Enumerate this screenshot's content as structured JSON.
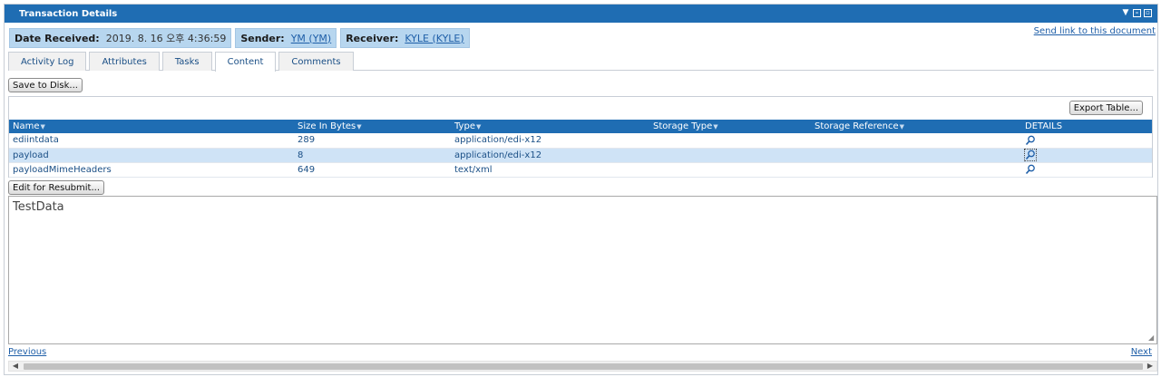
{
  "window": {
    "title": "Transaction Details"
  },
  "info": {
    "date_label": "Date Received:",
    "date_value": "2019. 8. 16 오후 4:36:59",
    "sender_label": "Sender:",
    "sender_value": "YM (YM)",
    "receiver_label": "Receiver:",
    "receiver_value": "KYLE (KYLE)",
    "send_link": "Send link to this document"
  },
  "tabs": [
    {
      "label": "Activity Log",
      "active": false
    },
    {
      "label": "Attributes",
      "active": false
    },
    {
      "label": "Tasks",
      "active": false
    },
    {
      "label": "Content",
      "active": true
    },
    {
      "label": "Comments",
      "active": false
    }
  ],
  "buttons": {
    "save": "Save to Disk...",
    "export": "Export Table...",
    "resubmit": "Edit for Resubmit..."
  },
  "table": {
    "columns": [
      "Name",
      "Size In Bytes",
      "Type",
      "Storage Type",
      "Storage Reference",
      "DETAILS"
    ],
    "rows": [
      {
        "name": "ediintdata",
        "size": "289",
        "type": "application/edi-x12",
        "storage_type": "",
        "storage_reference": ""
      },
      {
        "name": "payload",
        "size": "8",
        "type": "application/edi-x12",
        "storage_type": "",
        "storage_reference": ""
      },
      {
        "name": "payloadMimeHeaders",
        "size": "649",
        "type": "text/xml",
        "storage_type": "",
        "storage_reference": ""
      }
    ],
    "selected_row": 1
  },
  "content": {
    "text": "TestData"
  },
  "pager": {
    "previous": "Previous",
    "next": "Next"
  },
  "colors": {
    "header_blue": "#1f6db3",
    "info_bg": "#b7d6ef",
    "selected_row": "#cfe3f6",
    "link": "#1f5fa8"
  }
}
